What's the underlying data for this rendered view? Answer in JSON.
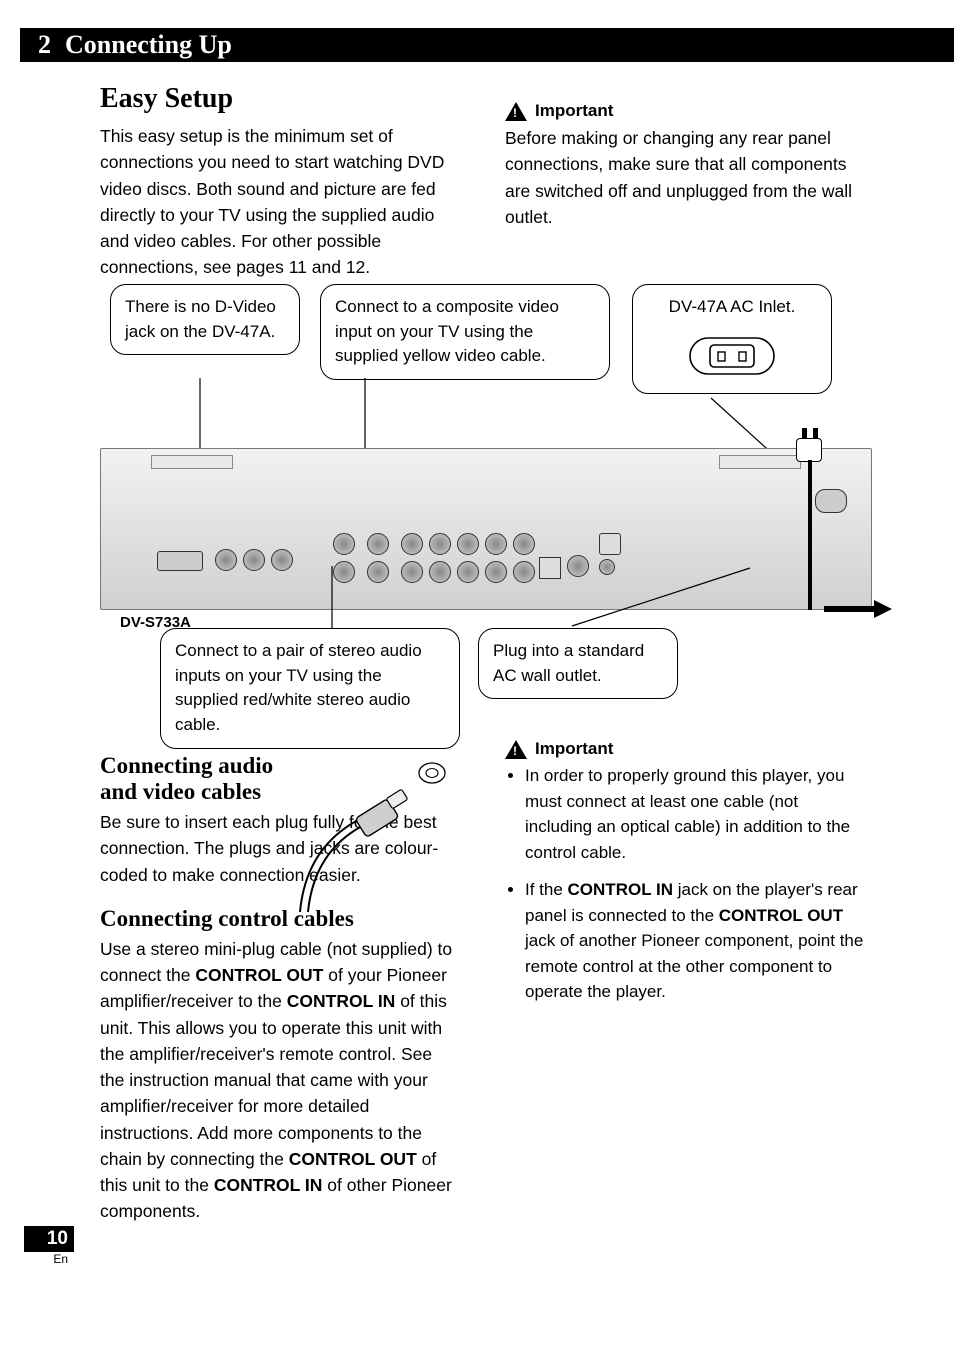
{
  "header": {
    "chapter_num": "2",
    "chapter_title": "Connecting Up"
  },
  "page": {
    "number": "10",
    "lang": "En"
  },
  "section_easy": {
    "title": "Easy Setup",
    "body": "This easy setup is the minimum set of connections you need to start watching DVD video discs. Both sound and picture are fed directly to your TV using the supplied audio and video cables. For other possible connections, see pages 11 and 12."
  },
  "important_top": {
    "label": "Important",
    "body": "Before making or changing any rear panel connections, make sure that all components are switched off and unplugged from the wall outlet."
  },
  "callouts": {
    "no_dvideo": "There is no D-Video jack on the DV-47A.",
    "composite": "Connect to a composite video input on your TV using the supplied yellow video cable.",
    "ac_label": "DV-47A AC Inlet.",
    "stereo_audio": "Connect to a pair of stereo audio inputs on your TV using the supplied red/white stereo audio cable.",
    "plug_wall": "Plug into a standard AC wall outlet."
  },
  "model_label": "DV-S733A",
  "section_av": {
    "title": "Connecting audio and video cables",
    "body": "Be sure to insert each plug fully for the best connection. The plugs and jacks are colour-coded to make connection easier."
  },
  "section_ctrl": {
    "title": "Connecting control cables",
    "body_before_co1": "Use a stereo mini-plug cable (not supplied) to connect the ",
    "co1": "CONTROL OUT",
    "body_mid1": " of your Pioneer amplifier/receiver to the ",
    "ci1": "CONTROL IN",
    "body_mid2": " of this unit. This allows you to operate this unit with the amplifier/receiver's remote control. See the instruction manual that came with your amplifier/receiver for more detailed instructions. Add more components to the chain by connecting the ",
    "co2": "CONTROL OUT",
    "body_mid3": " of this unit to the ",
    "ci2": "CONTROL IN",
    "body_end": " of other Pioneer components."
  },
  "important_bottom": {
    "label": "Important",
    "bullet1": "In order to properly ground this player, you must connect at least one cable (not including an optical cable) in addition to the control cable.",
    "bullet2_before": "If the ",
    "bullet2_ci": "CONTROL IN",
    "bullet2_mid": " jack on the player's rear panel is connected to the ",
    "bullet2_co": "CONTROL OUT",
    "bullet2_end": " jack of another Pioneer component, point the remote control at the other component to operate the player."
  }
}
